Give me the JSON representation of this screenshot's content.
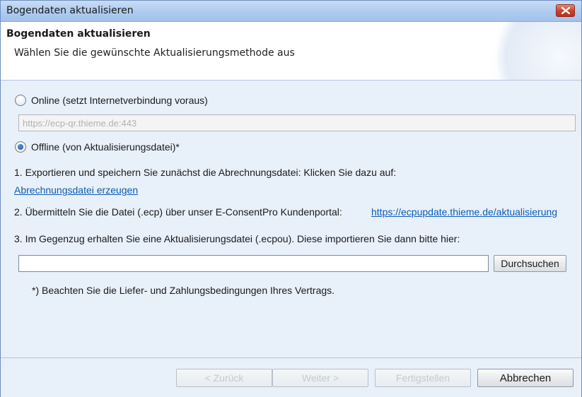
{
  "window": {
    "title": "Bogendaten aktualisieren",
    "close_icon": "close-icon"
  },
  "header": {
    "title": "Bogendaten aktualisieren",
    "subtitle": "Wählen Sie die gewünschte Aktualisierungsmethode aus"
  },
  "online": {
    "label": "Online (setzt Internetverbindung voraus)",
    "checked": false,
    "url_value": "https://ecp-qr.thieme.de:443"
  },
  "offline": {
    "label": "Offline (von Aktualisierungsdatei)*",
    "checked": true
  },
  "steps": {
    "step1": "1. Exportieren und speichern Sie zunächst die Abrechnungsdatei: Klicken Sie dazu auf:",
    "step1_link": "Abrechnungsdatei erzeugen",
    "step2": "2. Übermitteln Sie die Datei (.ecp) über unser E-ConsentPro Kundenportal:",
    "step2_link": "https://ecpupdate.thieme.de/aktualisierung",
    "step3": "3. Im Gegenzug erhalten Sie eine Aktualisierungsdatei (.ecpou). Diese importieren Sie dann bitte hier:",
    "file_value": "",
    "browse_label": "Durchsuchen",
    "note": "*) Beachten Sie die Liefer- und Zahlungsbedingungen Ihres Vertrags."
  },
  "footer": {
    "back_label": "< Zurück",
    "next_label": "Weiter >",
    "finish_label": "Fertigstellen",
    "cancel_label": "Abbrechen"
  }
}
